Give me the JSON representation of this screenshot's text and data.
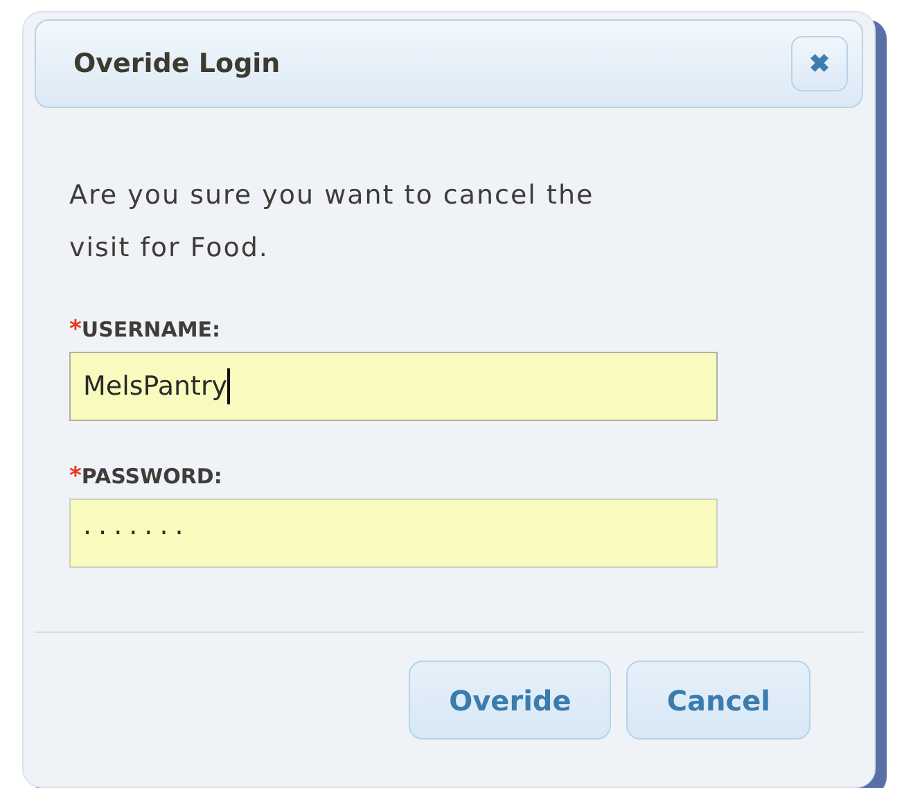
{
  "dialog": {
    "title": "Overide Login",
    "close": "✖"
  },
  "message": "Are you sure you want to cancel the visit for Food.",
  "fields": [
    {
      "required_mark": "*",
      "label": "USERNAME:",
      "value": "MelsPantry",
      "focused": true
    },
    {
      "required_mark": "*",
      "label": "PASSWORD:",
      "value": "·······",
      "focused": false
    }
  ],
  "buttons": [
    "Overide",
    "Cancel"
  ]
}
